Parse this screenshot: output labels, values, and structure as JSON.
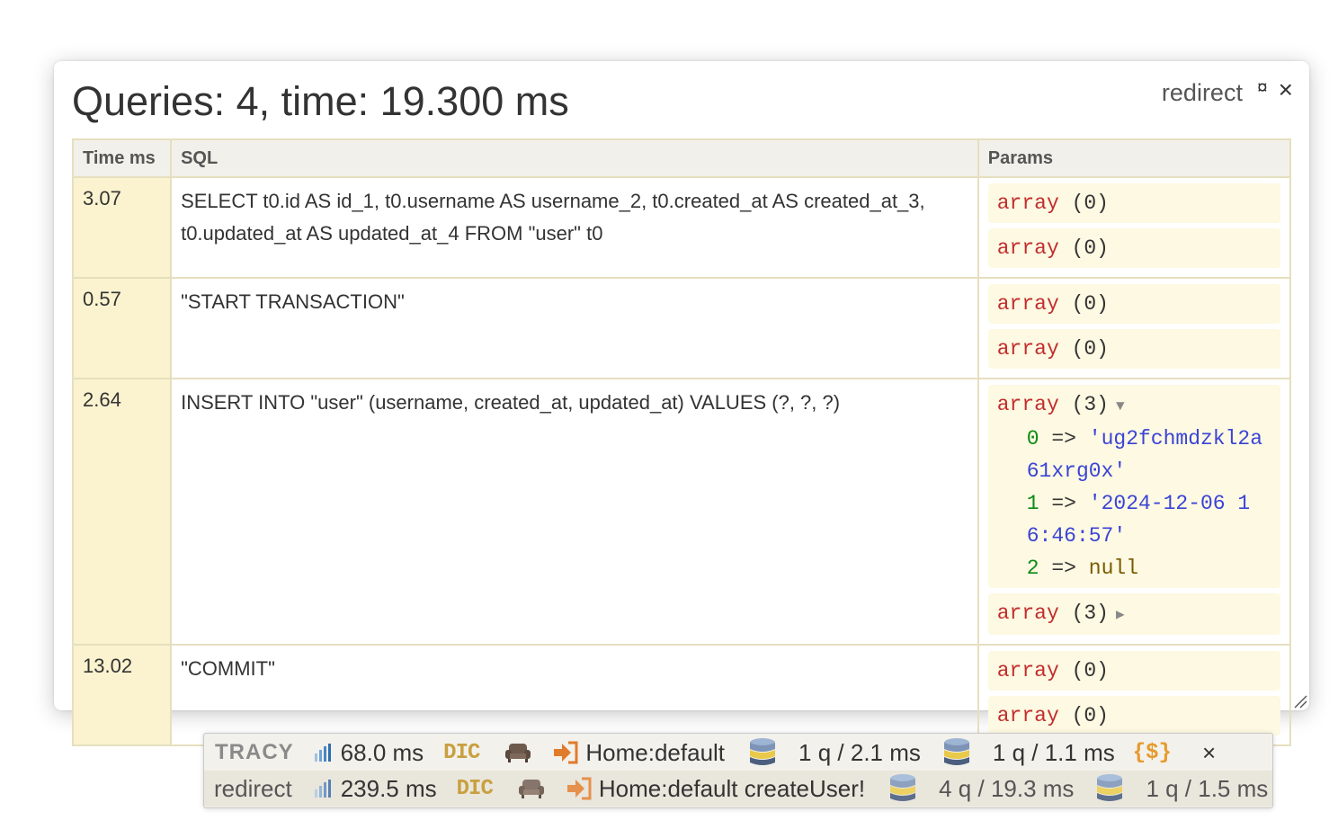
{
  "panel": {
    "title": "Queries: 4, time: 19.300 ms",
    "mode": "redirect",
    "pin_icon": "¤",
    "close_icon": "×"
  },
  "table": {
    "headers": {
      "time": "Time ms",
      "sql": "SQL",
      "params": "Params"
    },
    "rows": [
      {
        "time": "3.07",
        "sql": "SELECT t0.id AS id_1, t0.username AS username_2, t0.created_at AS created_at_3, t0.updated_at AS updated_at_4 FROM \"user\" t0"
      },
      {
        "time": "0.57",
        "sql": "\"START TRANSACTION\""
      },
      {
        "time": "2.64",
        "sql": "INSERT INTO \"user\" (username, created_at, updated_at) VALUES (?, ?, ?)"
      },
      {
        "time": "13.02",
        "sql": "\"COMMIT\""
      }
    ]
  },
  "dump": {
    "array_kw": "array",
    "empty_count": "(0)",
    "three_count": "(3)",
    "expanded_arrow": "▼",
    "collapsed_arrow": "▶",
    "arrow_op": "=>",
    "items": [
      {
        "key": "0",
        "value": "'ug2fchmdzkl2a61xrg0x'"
      },
      {
        "key": "1",
        "value": "'2024-12-06 16:46:57'"
      },
      {
        "key": "2",
        "value": "null"
      }
    ]
  },
  "tracy_bar": {
    "row1": {
      "logo": "TRACY",
      "time": "68.0 ms",
      "dic": "DIC",
      "route": "Home:default",
      "db1": "1 q / 2.1 ms",
      "db2": "1 q / 1.1 ms",
      "php": "{$}",
      "close": "×"
    },
    "row2": {
      "label": "redirect",
      "time": "239.5 ms",
      "dic": "DIC",
      "route": "Home:default createUser!",
      "db1": "4 q / 19.3 ms",
      "db2": "1 q / 1.5 ms"
    }
  },
  "colors": {
    "time_cell_bg": "#fbf3cf",
    "dump_bg": "#fdf9e2",
    "keyword": "#c22d2d",
    "number": "#0c8a15",
    "string": "#3a44d6"
  }
}
